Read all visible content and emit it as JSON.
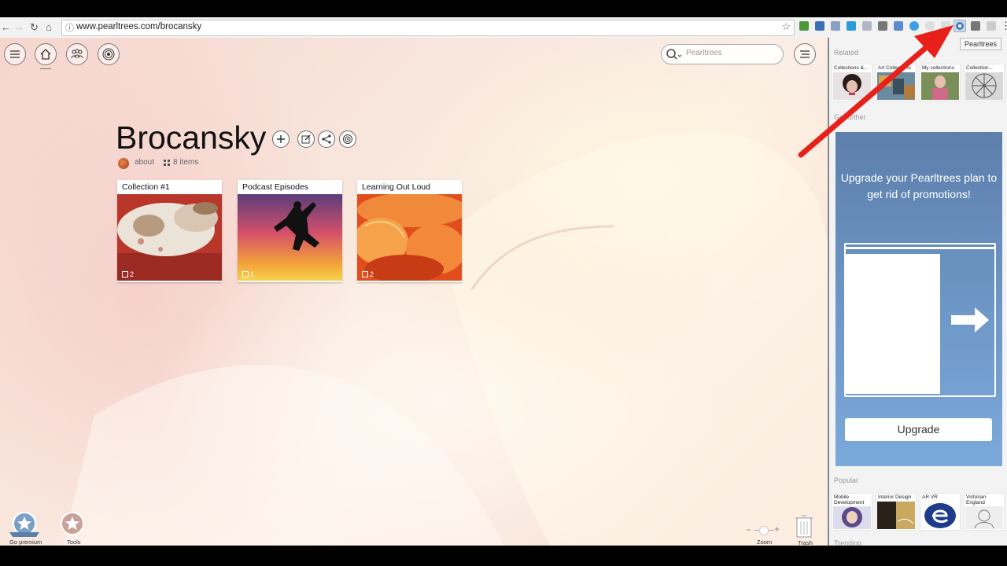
{
  "browser": {
    "url": "www.pearltrees.com/brocansky",
    "tooltip": "Pearltrees"
  },
  "page": {
    "search_placeholder": "Pearltrees",
    "title": "Brocansky",
    "about_label": "about",
    "items_label": "8 items",
    "collections": [
      {
        "title": "Collection #1",
        "count": "2"
      },
      {
        "title": "Podcast Episodes",
        "count": "1"
      },
      {
        "title": "Learning Out Loud",
        "count": "2"
      }
    ],
    "bottom": {
      "go_premium": "Go premium",
      "tools": "Tools",
      "zoom": "Zoom",
      "trash": "Trash",
      "zoom_minus": "−",
      "zoom_plus": "+"
    }
  },
  "sidebar": {
    "related_label": "Related",
    "related": [
      {
        "label": "Collections &..."
      },
      {
        "label": "Art Collections"
      },
      {
        "label": "My collections"
      },
      {
        "label": "Collection..."
      }
    ],
    "go_further_label": "Go further",
    "promo_text": "Upgrade your Pearltrees plan to get rid of promotions!",
    "upgrade_label": "Upgrade",
    "popular_label": "Popular",
    "popular": [
      {
        "label": "Mobile Development"
      },
      {
        "label": "Interior Design"
      },
      {
        "label": "AR VR"
      },
      {
        "label": "Victorian England"
      }
    ],
    "trending_label": "Trending"
  },
  "colors": {
    "promo_blue": "#6a90c0",
    "annotation_arrow": "#e8201a"
  }
}
